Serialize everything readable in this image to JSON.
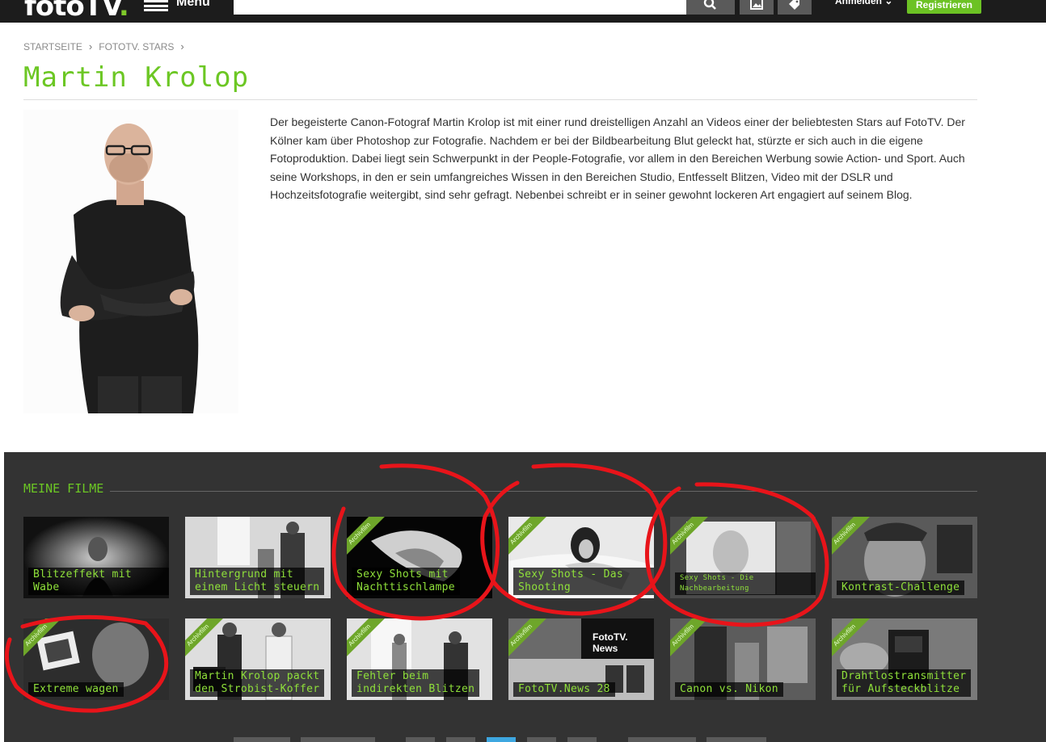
{
  "header": {
    "logo_text": "fotoTV",
    "logo_dot": ".",
    "menu_label": "Menü",
    "search_placeholder": "",
    "login_label": "Anmelden",
    "register_label": "Registrieren"
  },
  "breadcrumb": [
    "STARTSEITE",
    "FOTOTV. STARS"
  ],
  "page": {
    "title": "Martin Krolop",
    "bio": "Der begeisterte Canon-Fotograf Martin Krolop ist mit einer rund dreistelligen Anzahl an Videos einer der beliebtesten Stars auf FotoTV. Der Kölner kam über Photoshop zur Fotografie. Nachdem er bei der Bildbearbeitung Blut geleckt hat, stürzte er sich auch in die eigene Fotoproduktion. Dabei liegt sein Schwerpunkt in der People-Fotografie, vor allem in den Bereichen Werbung sowie Action- und Sport. Auch seine Workshops, in den er sein umfangreiches Wissen in den Bereichen Studio, Entfesselt Blitzen, Video mit der DSLR und Hochzeitsfotografie weitergibt, sind sehr gefragt. Nebenbei schreibt er in seiner gewohnt lockeren Art engagiert auf seinem Blog."
  },
  "films": {
    "section_title": "MEINE FILME",
    "ribbon_label": "Archivfilm",
    "tiles": [
      {
        "label": "Blitzeffekt mit Wabe",
        "archive": false
      },
      {
        "label": "Hintergrund mit\neinem Licht steuern",
        "archive": false
      },
      {
        "label": "Sexy Shots mit\nNachttischlampe",
        "archive": true
      },
      {
        "label": "Sexy Shots - Das Shooting",
        "archive": true
      },
      {
        "label": "Sexy Shots - Die Nachbearbeitung",
        "archive": true
      },
      {
        "label": "Kontrast-Challenge",
        "archive": true
      },
      {
        "label": "Extreme wagen",
        "archive": true
      },
      {
        "label": "Martin Krolop packt\nden Strobist-Koffer",
        "archive": true
      },
      {
        "label": "Fehler beim\nindirekten Blitzen",
        "archive": true
      },
      {
        "label": "FotoTV.News 28",
        "archive": true
      },
      {
        "label": "Canon vs. Nikon",
        "archive": true
      },
      {
        "label": "Drahtlostransmitter\nfür Aufsteckblitze",
        "archive": true
      }
    ],
    "news_logo": "FotoTV. News"
  },
  "colors": {
    "accent": "#6cc724",
    "topbar": "#1c1c1c",
    "films_bg": "#333333",
    "annotation": "#e8141a"
  }
}
